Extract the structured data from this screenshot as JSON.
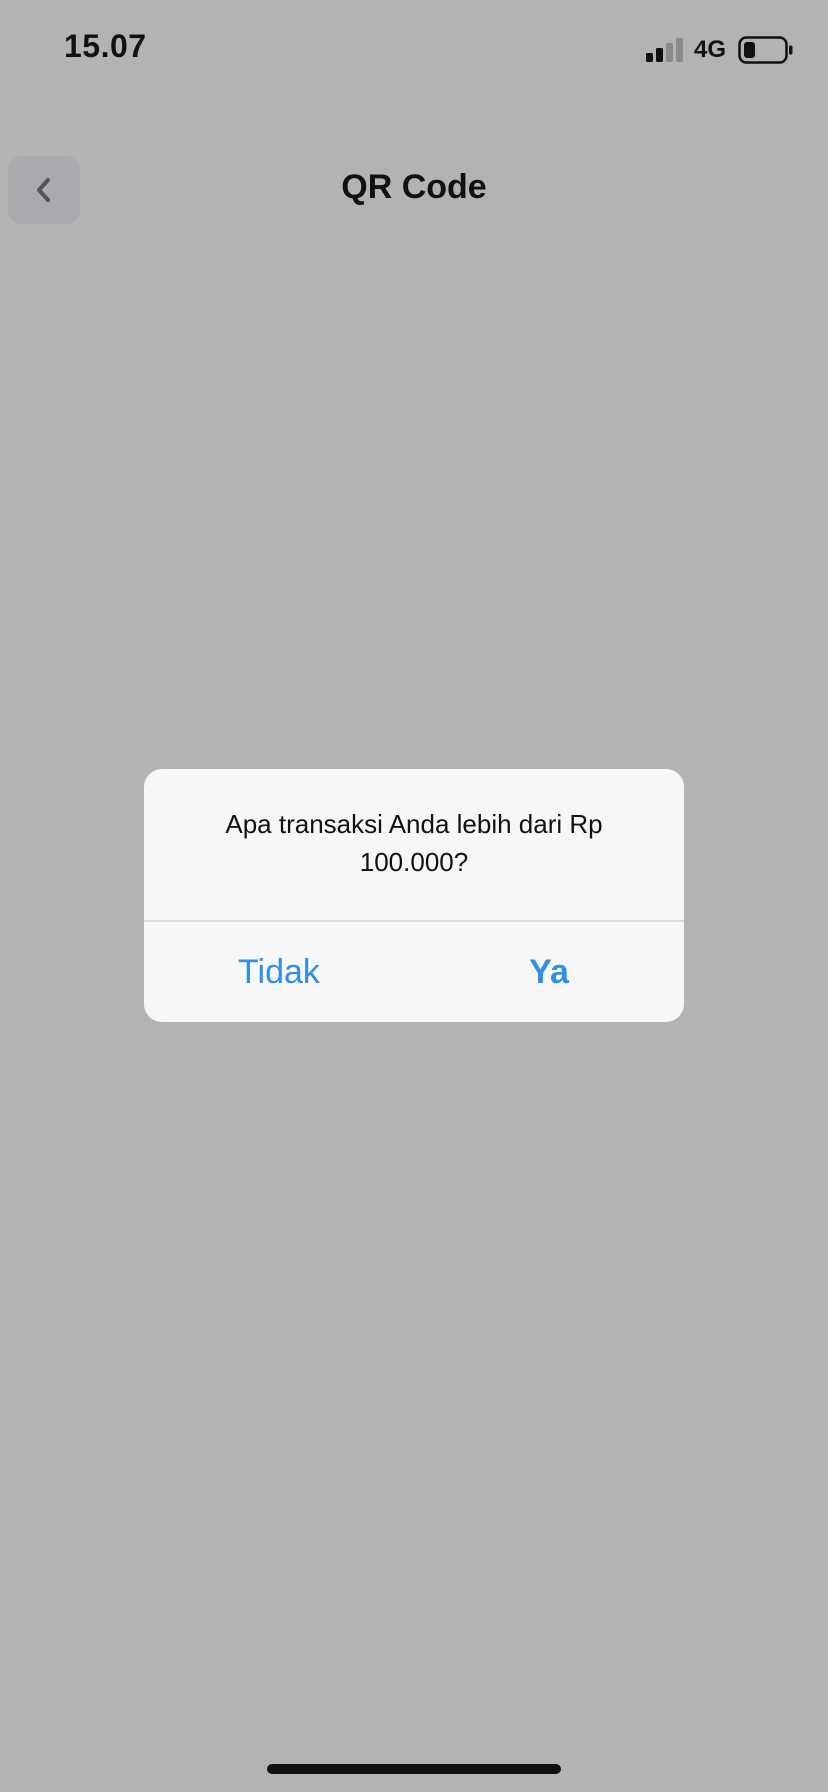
{
  "status_bar": {
    "time": "15.07",
    "network": "4G",
    "icons": [
      "signal-icon",
      "battery-icon"
    ]
  },
  "header": {
    "back_icon": "chevron-left-icon",
    "title": "QR Code"
  },
  "dialog": {
    "message": "Apa transaksi Anda lebih dari Rp 100.000?",
    "buttons": {
      "no_label": "Tidak",
      "yes_label": "Ya"
    }
  },
  "colors": {
    "overlay_background": "#b3b3b3",
    "dialog_background": "#f7f7f7",
    "accent": "#2e8fe6",
    "text": "#111111"
  }
}
